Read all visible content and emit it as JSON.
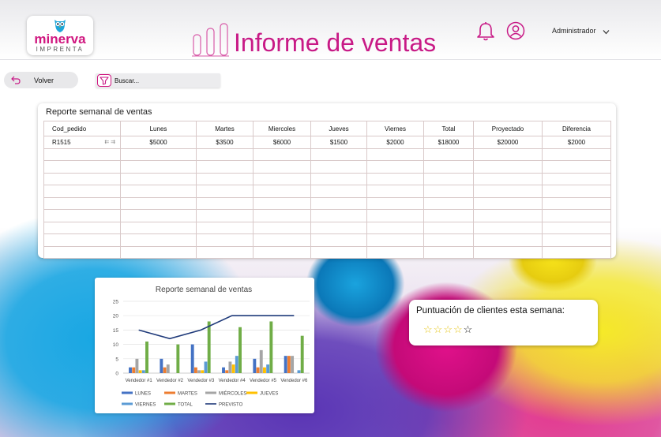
{
  "header": {
    "logo_name": "minerva",
    "logo_sub": "IMPRENTA",
    "title": "Informe de ventas",
    "user": "Administrador"
  },
  "toolbar": {
    "back_label": "Volver",
    "search_placeholder": "Buscar..."
  },
  "table": {
    "title": "Reporte semanal de ventas",
    "columns": [
      "Cod_pedido",
      "Lunes",
      "Martes",
      "Miercoles",
      "Jueves",
      "Viernes",
      "Total",
      "Proyectado",
      "Diferencia"
    ],
    "rows": [
      [
        "R1515",
        "$5000",
        "$3500",
        "$6000",
        "$1500",
        "$2000",
        "$18000",
        "$20000",
        "$2000"
      ]
    ],
    "empty_rows": 9
  },
  "chart_data": {
    "type": "bar",
    "title": "Reporte semanal de ventas",
    "categories": [
      "Vendedor #1",
      "Vendedor #2",
      "Vendedor #3",
      "Vendedor #4",
      "Vendedor #5",
      "Vendedor #6"
    ],
    "ylim": [
      0,
      25
    ],
    "yticks": [
      0,
      5,
      10,
      15,
      20,
      25
    ],
    "grid": true,
    "legend": "bottom",
    "series": [
      {
        "name": "LUNES",
        "color": "#4472c4",
        "values": [
          2,
          5,
          10,
          2,
          5,
          6
        ]
      },
      {
        "name": "MARTES",
        "color": "#ed7d31",
        "values": [
          2,
          2,
          2,
          1,
          2,
          6
        ]
      },
      {
        "name": "MIÉRCOLES",
        "color": "#a5a5a5",
        "values": [
          5,
          3,
          1,
          4,
          8,
          6
        ]
      },
      {
        "name": "JUEVES",
        "color": "#ffc000",
        "values": [
          1,
          0,
          1,
          3,
          2,
          0
        ]
      },
      {
        "name": "VIERNES",
        "color": "#5b9bd5",
        "values": [
          1,
          0,
          4,
          6,
          3,
          1
        ]
      },
      {
        "name": "TOTAL",
        "color": "#70ad47",
        "values": [
          11,
          10,
          18,
          16,
          18,
          13
        ]
      },
      {
        "name": "PREVISTO",
        "color": "#1f3a7a",
        "type": "line",
        "values": [
          15,
          12,
          15,
          20,
          20,
          20
        ]
      }
    ]
  },
  "rating": {
    "label": "Puntuación de clientes esta semana:",
    "stars_filled": 4,
    "stars_total": 5,
    "filled_color": "#e6c619"
  },
  "colors": {
    "brand": "#c81a86",
    "owl": "#1ea6d8"
  }
}
